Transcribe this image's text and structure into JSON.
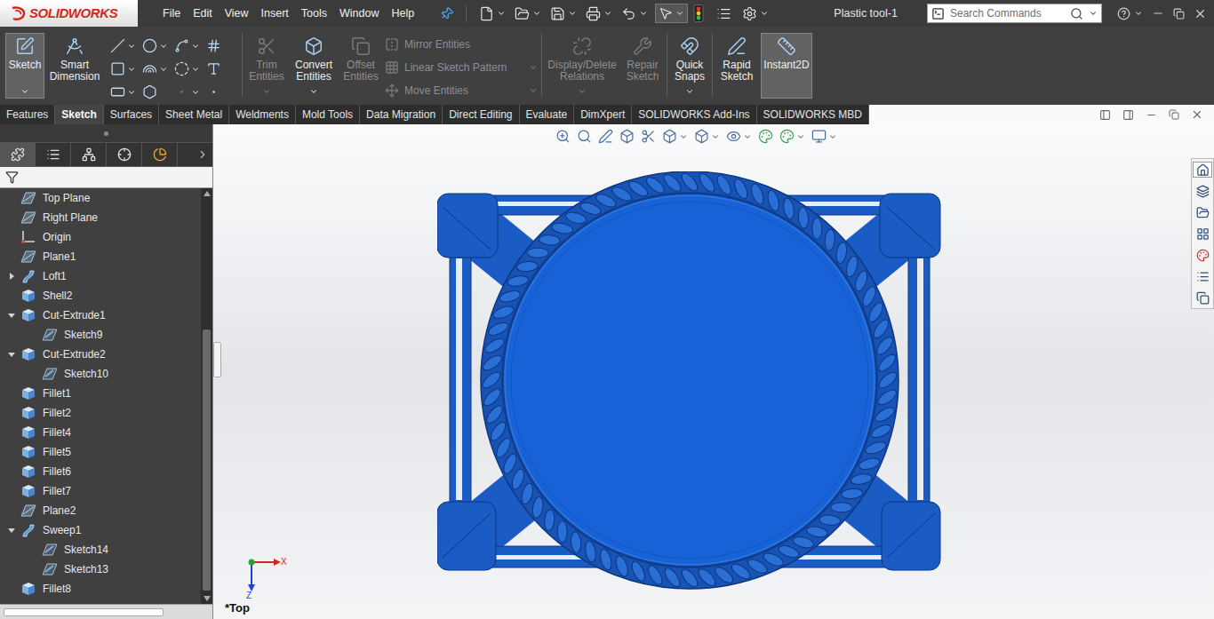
{
  "app": {
    "logo": "SOLIDWORKS",
    "title": "Plastic tool-1"
  },
  "menu": [
    "File",
    "Edit",
    "View",
    "Insert",
    "Tools",
    "Window",
    "Help"
  ],
  "search": {
    "placeholder": "Search Commands"
  },
  "commandGroups": [
    [
      {
        "kind": "large",
        "label": "Sketch",
        "selected": true,
        "disabled": false,
        "dropdown": true
      },
      {
        "kind": "large",
        "label": "Smart Dimension",
        "selected": false,
        "disabled": false,
        "dropdown": false
      },
      {
        "kind": "tools"
      }
    ],
    [
      {
        "kind": "large",
        "label": "Trim Entities",
        "selected": false,
        "disabled": true,
        "dropdown": true
      },
      {
        "kind": "large",
        "label": "Convert Entities",
        "selected": false,
        "disabled": false,
        "dropdown": true
      },
      {
        "kind": "large",
        "label": "Offset Entities",
        "selected": false,
        "disabled": true,
        "dropdown": false
      },
      {
        "kind": "stack",
        "rows": [
          {
            "label": "Mirror Entities",
            "disabled": true,
            "dropdown": false
          },
          {
            "label": "Linear Sketch Pattern",
            "disabled": true,
            "dropdown": true
          },
          {
            "label": "Move Entities",
            "disabled": true,
            "dropdown": true
          }
        ]
      }
    ],
    [
      {
        "kind": "large",
        "label": "Display/Delete Relations",
        "selected": false,
        "disabled": true,
        "dropdown": true
      },
      {
        "kind": "large",
        "label": "Repair Sketch",
        "selected": false,
        "disabled": true,
        "dropdown": false
      }
    ],
    [
      {
        "kind": "large",
        "label": "Quick Snaps",
        "selected": false,
        "disabled": false,
        "dropdown": true
      }
    ],
    [
      {
        "kind": "large",
        "label": "Rapid Sketch",
        "selected": false,
        "disabled": false,
        "dropdown": false
      },
      {
        "kind": "large",
        "label": "Instant2D",
        "selected": true,
        "disabled": false,
        "dropdown": false
      }
    ]
  ],
  "tabs": [
    {
      "label": "Features",
      "selected": false
    },
    {
      "label": "Sketch",
      "selected": true
    },
    {
      "label": "Surfaces",
      "selected": false
    },
    {
      "label": "Sheet Metal",
      "selected": false
    },
    {
      "label": "Weldments",
      "selected": false
    },
    {
      "label": "Mold Tools",
      "selected": false
    },
    {
      "label": "Data Migration",
      "selected": false
    },
    {
      "label": "Direct Editing",
      "selected": false
    },
    {
      "label": "Evaluate",
      "selected": false
    },
    {
      "label": "DimXpert",
      "selected": false
    },
    {
      "label": "SOLIDWORKS Add-Ins",
      "selected": false
    },
    {
      "label": "SOLIDWORKS MBD",
      "selected": false
    }
  ],
  "tree": [
    {
      "label": "Top Plane",
      "kind": "plane",
      "expandable": false,
      "expanded": false,
      "children": []
    },
    {
      "label": "Right Plane",
      "kind": "plane",
      "expandable": false,
      "expanded": false,
      "children": []
    },
    {
      "label": "Origin",
      "kind": "origin",
      "expandable": false,
      "expanded": false,
      "children": []
    },
    {
      "label": "Plane1",
      "kind": "plane",
      "expandable": false,
      "expanded": false,
      "children": []
    },
    {
      "label": "Loft1",
      "kind": "loft",
      "expandable": true,
      "expanded": false,
      "children": []
    },
    {
      "label": "Shell2",
      "kind": "feature",
      "expandable": false,
      "expanded": false,
      "children": []
    },
    {
      "label": "Cut-Extrude1",
      "kind": "feature",
      "expandable": true,
      "expanded": true,
      "children": [
        {
          "label": "Sketch9",
          "kind": "sketch"
        }
      ]
    },
    {
      "label": "Cut-Extrude2",
      "kind": "feature",
      "expandable": true,
      "expanded": true,
      "children": [
        {
          "label": "Sketch10",
          "kind": "sketch"
        }
      ]
    },
    {
      "label": "Fillet1",
      "kind": "feature",
      "expandable": false,
      "expanded": false,
      "children": []
    },
    {
      "label": "Fillet2",
      "kind": "feature",
      "expandable": false,
      "expanded": false,
      "children": []
    },
    {
      "label": "Fillet4",
      "kind": "feature",
      "expandable": false,
      "expanded": false,
      "children": []
    },
    {
      "label": "Fillet5",
      "kind": "feature",
      "expandable": false,
      "expanded": false,
      "children": []
    },
    {
      "label": "Fillet6",
      "kind": "feature",
      "expandable": false,
      "expanded": false,
      "children": []
    },
    {
      "label": "Fillet7",
      "kind": "feature",
      "expandable": false,
      "expanded": false,
      "children": []
    },
    {
      "label": "Plane2",
      "kind": "plane",
      "expandable": false,
      "expanded": false,
      "children": []
    },
    {
      "label": "Sweep1",
      "kind": "sweep",
      "expandable": true,
      "expanded": true,
      "children": [
        {
          "label": "Sketch14",
          "kind": "sketch"
        },
        {
          "label": "Sketch13",
          "kind": "sketch"
        }
      ]
    },
    {
      "label": "Fillet8",
      "kind": "feature",
      "expandable": false,
      "expanded": false,
      "children": []
    }
  ],
  "viewport": {
    "view": "*Top",
    "axes": {
      "x": "X",
      "z": "Z"
    }
  }
}
